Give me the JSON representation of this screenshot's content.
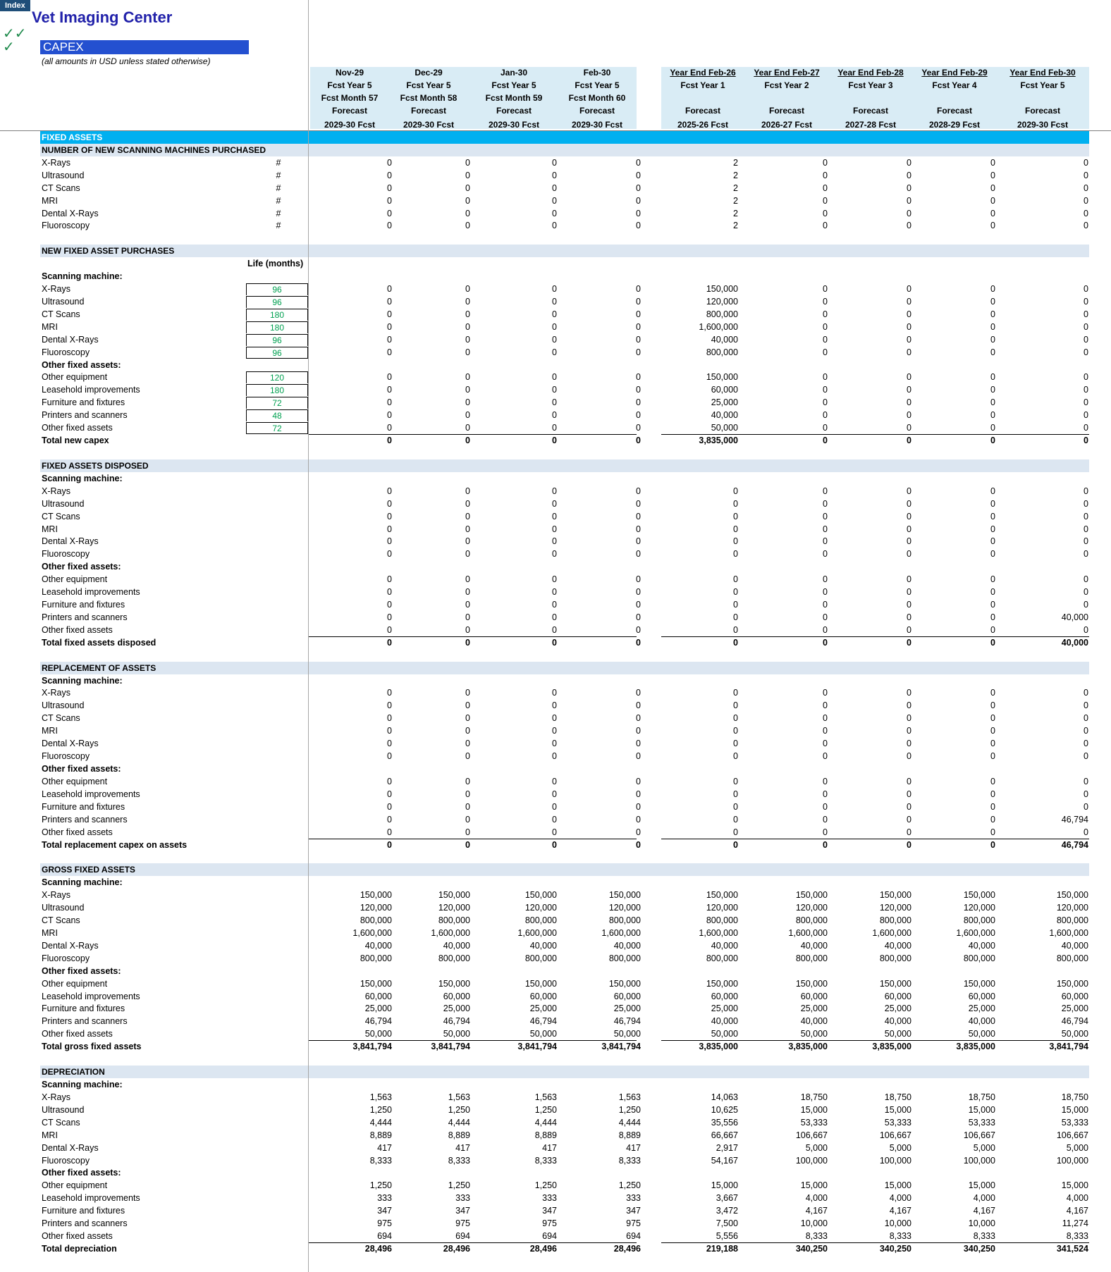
{
  "index_tab": "Index",
  "title": "Vet Imaging Center",
  "checks": [
    "✓✓",
    "✓"
  ],
  "sheet": {
    "title": "CAPEX",
    "subtitle": "(all amounts in USD unless stated otherwise)"
  },
  "colors": {
    "title": "#2222aa",
    "sheet_title_bg": "#2450d0",
    "section_bar": "#00b0f0",
    "section_band": "#dce6f1",
    "header_bg": "#d9ecf5",
    "life_text": "#00a050"
  },
  "columns": [
    {
      "lines": [
        "Nov-29",
        "Fcst Year 5",
        "Fcst Month 57",
        "Forecast",
        "2029-30 Fcst"
      ],
      "underline": false
    },
    {
      "lines": [
        "Dec-29",
        "Fcst Year 5",
        "Fcst Month 58",
        "Forecast",
        "2029-30 Fcst"
      ],
      "underline": false
    },
    {
      "lines": [
        "Jan-30",
        "Fcst Year 5",
        "Fcst Month 59",
        "Forecast",
        "2029-30 Fcst"
      ],
      "underline": false
    },
    {
      "lines": [
        "Feb-30",
        "Fcst Year 5",
        "Fcst Month 60",
        "Forecast",
        "2029-30 Fcst"
      ],
      "underline": false
    },
    {
      "lines": [
        "Year End  Feb-26",
        "Fcst Year 1",
        "",
        "Forecast",
        "2025-26 Fcst"
      ],
      "underline": true
    },
    {
      "lines": [
        "Year End  Feb-27",
        "Fcst Year 2",
        "",
        "Forecast",
        "2026-27 Fcst"
      ],
      "underline": true
    },
    {
      "lines": [
        "Year End  Feb-28",
        "Fcst Year 3",
        "",
        "Forecast",
        "2027-28 Fcst"
      ],
      "underline": true
    },
    {
      "lines": [
        "Year End  Feb-29",
        "Fcst Year 4",
        "",
        "Forecast",
        "2028-29 Fcst"
      ],
      "underline": true
    },
    {
      "lines": [
        "Year End  Feb-30",
        "Fcst Year 5",
        "",
        "Forecast",
        "2029-30 Fcst"
      ],
      "underline": true
    }
  ],
  "life_header": "Life (months)",
  "rows": [
    {
      "k": "bar",
      "label": "FIXED ASSETS"
    },
    {
      "k": "band",
      "label": "NUMBER OF NEW SCANNING MACHINES PURCHASED"
    },
    {
      "k": "data",
      "label": "X-Rays",
      "unit": "#",
      "v": [
        "0",
        "0",
        "0",
        "0",
        "2",
        "0",
        "0",
        "0",
        "0"
      ]
    },
    {
      "k": "data",
      "label": "Ultrasound",
      "unit": "#",
      "v": [
        "0",
        "0",
        "0",
        "0",
        "2",
        "0",
        "0",
        "0",
        "0"
      ]
    },
    {
      "k": "data",
      "label": "CT Scans",
      "unit": "#",
      "v": [
        "0",
        "0",
        "0",
        "0",
        "2",
        "0",
        "0",
        "0",
        "0"
      ]
    },
    {
      "k": "data",
      "label": "MRI",
      "unit": "#",
      "v": [
        "0",
        "0",
        "0",
        "0",
        "2",
        "0",
        "0",
        "0",
        "0"
      ]
    },
    {
      "k": "data",
      "label": "Dental X-Rays",
      "unit": "#",
      "v": [
        "0",
        "0",
        "0",
        "0",
        "2",
        "0",
        "0",
        "0",
        "0"
      ]
    },
    {
      "k": "data",
      "label": "Fluoroscopy",
      "unit": "#",
      "v": [
        "0",
        "0",
        "0",
        "0",
        "2",
        "0",
        "0",
        "0",
        "0"
      ]
    },
    {
      "k": "blank"
    },
    {
      "k": "band",
      "label": "NEW FIXED ASSET PURCHASES"
    },
    {
      "k": "lifehdr"
    },
    {
      "k": "sub",
      "label": "Scanning machine:"
    },
    {
      "k": "data",
      "label": "X-Rays",
      "life": "96",
      "v": [
        "0",
        "0",
        "0",
        "0",
        "150,000",
        "0",
        "0",
        "0",
        "0"
      ]
    },
    {
      "k": "data",
      "label": "Ultrasound",
      "life": "96",
      "v": [
        "0",
        "0",
        "0",
        "0",
        "120,000",
        "0",
        "0",
        "0",
        "0"
      ]
    },
    {
      "k": "data",
      "label": "CT Scans",
      "life": "180",
      "v": [
        "0",
        "0",
        "0",
        "0",
        "800,000",
        "0",
        "0",
        "0",
        "0"
      ]
    },
    {
      "k": "data",
      "label": "MRI",
      "life": "180",
      "v": [
        "0",
        "0",
        "0",
        "0",
        "1,600,000",
        "0",
        "0",
        "0",
        "0"
      ]
    },
    {
      "k": "data",
      "label": "Dental X-Rays",
      "life": "96",
      "v": [
        "0",
        "0",
        "0",
        "0",
        "40,000",
        "0",
        "0",
        "0",
        "0"
      ]
    },
    {
      "k": "data",
      "label": "Fluoroscopy",
      "life": "96",
      "lifelast": true,
      "v": [
        "0",
        "0",
        "0",
        "0",
        "800,000",
        "0",
        "0",
        "0",
        "0"
      ]
    },
    {
      "k": "sub",
      "label": "Other fixed assets:"
    },
    {
      "k": "data",
      "label": "Other equipment",
      "life": "120",
      "v": [
        "0",
        "0",
        "0",
        "0",
        "150,000",
        "0",
        "0",
        "0",
        "0"
      ]
    },
    {
      "k": "data",
      "label": "Leasehold improvements",
      "life": "180",
      "v": [
        "0",
        "0",
        "0",
        "0",
        "60,000",
        "0",
        "0",
        "0",
        "0"
      ]
    },
    {
      "k": "data",
      "label": "Furniture and fixtures",
      "life": "72",
      "v": [
        "0",
        "0",
        "0",
        "0",
        "25,000",
        "0",
        "0",
        "0",
        "0"
      ]
    },
    {
      "k": "data",
      "label": "Printers and scanners",
      "life": "48",
      "v": [
        "0",
        "0",
        "0",
        "0",
        "40,000",
        "0",
        "0",
        "0",
        "0"
      ]
    },
    {
      "k": "data",
      "label": "Other fixed assets",
      "life": "72",
      "lifelast": true,
      "v": [
        "0",
        "0",
        "0",
        "0",
        "50,000",
        "0",
        "0",
        "0",
        "0"
      ]
    },
    {
      "k": "total",
      "label": "Total new capex",
      "v": [
        "0",
        "0",
        "0",
        "0",
        "3,835,000",
        "0",
        "0",
        "0",
        "0"
      ]
    },
    {
      "k": "blank"
    },
    {
      "k": "band",
      "label": "FIXED ASSETS DISPOSED"
    },
    {
      "k": "sub",
      "label": "Scanning machine:"
    },
    {
      "k": "data",
      "label": "X-Rays",
      "v": [
        "0",
        "0",
        "0",
        "0",
        "0",
        "0",
        "0",
        "0",
        "0"
      ]
    },
    {
      "k": "data",
      "label": "Ultrasound",
      "v": [
        "0",
        "0",
        "0",
        "0",
        "0",
        "0",
        "0",
        "0",
        "0"
      ]
    },
    {
      "k": "data",
      "label": "CT Scans",
      "v": [
        "0",
        "0",
        "0",
        "0",
        "0",
        "0",
        "0",
        "0",
        "0"
      ]
    },
    {
      "k": "data",
      "label": "MRI",
      "v": [
        "0",
        "0",
        "0",
        "0",
        "0",
        "0",
        "0",
        "0",
        "0"
      ]
    },
    {
      "k": "data",
      "label": "Dental X-Rays",
      "v": [
        "0",
        "0",
        "0",
        "0",
        "0",
        "0",
        "0",
        "0",
        "0"
      ]
    },
    {
      "k": "data",
      "label": "Fluoroscopy",
      "v": [
        "0",
        "0",
        "0",
        "0",
        "0",
        "0",
        "0",
        "0",
        "0"
      ]
    },
    {
      "k": "sub",
      "label": "Other fixed assets:"
    },
    {
      "k": "data",
      "label": "Other equipment",
      "v": [
        "0",
        "0",
        "0",
        "0",
        "0",
        "0",
        "0",
        "0",
        "0"
      ]
    },
    {
      "k": "data",
      "label": "Leasehold improvements",
      "v": [
        "0",
        "0",
        "0",
        "0",
        "0",
        "0",
        "0",
        "0",
        "0"
      ]
    },
    {
      "k": "data",
      "label": "Furniture and fixtures",
      "v": [
        "0",
        "0",
        "0",
        "0",
        "0",
        "0",
        "0",
        "0",
        "0"
      ]
    },
    {
      "k": "data",
      "label": "Printers and scanners",
      "v": [
        "0",
        "0",
        "0",
        "0",
        "0",
        "0",
        "0",
        "0",
        "40,000"
      ]
    },
    {
      "k": "data",
      "label": "Other fixed assets",
      "v": [
        "0",
        "0",
        "0",
        "0",
        "0",
        "0",
        "0",
        "0",
        "0"
      ]
    },
    {
      "k": "total",
      "label": "Total fixed assets disposed",
      "v": [
        "0",
        "0",
        "0",
        "0",
        "0",
        "0",
        "0",
        "0",
        "40,000"
      ]
    },
    {
      "k": "blank"
    },
    {
      "k": "band",
      "label": "REPLACEMENT OF ASSETS"
    },
    {
      "k": "sub",
      "label": "Scanning machine:"
    },
    {
      "k": "data",
      "label": "X-Rays",
      "v": [
        "0",
        "0",
        "0",
        "0",
        "0",
        "0",
        "0",
        "0",
        "0"
      ]
    },
    {
      "k": "data",
      "label": "Ultrasound",
      "v": [
        "0",
        "0",
        "0",
        "0",
        "0",
        "0",
        "0",
        "0",
        "0"
      ]
    },
    {
      "k": "data",
      "label": "CT Scans",
      "v": [
        "0",
        "0",
        "0",
        "0",
        "0",
        "0",
        "0",
        "0",
        "0"
      ]
    },
    {
      "k": "data",
      "label": "MRI",
      "v": [
        "0",
        "0",
        "0",
        "0",
        "0",
        "0",
        "0",
        "0",
        "0"
      ]
    },
    {
      "k": "data",
      "label": "Dental X-Rays",
      "v": [
        "0",
        "0",
        "0",
        "0",
        "0",
        "0",
        "0",
        "0",
        "0"
      ]
    },
    {
      "k": "data",
      "label": "Fluoroscopy",
      "v": [
        "0",
        "0",
        "0",
        "0",
        "0",
        "0",
        "0",
        "0",
        "0"
      ]
    },
    {
      "k": "sub",
      "label": "Other fixed assets:"
    },
    {
      "k": "data",
      "label": "Other equipment",
      "v": [
        "0",
        "0",
        "0",
        "0",
        "0",
        "0",
        "0",
        "0",
        "0"
      ]
    },
    {
      "k": "data",
      "label": "Leasehold improvements",
      "v": [
        "0",
        "0",
        "0",
        "0",
        "0",
        "0",
        "0",
        "0",
        "0"
      ]
    },
    {
      "k": "data",
      "label": "Furniture and fixtures",
      "v": [
        "0",
        "0",
        "0",
        "0",
        "0",
        "0",
        "0",
        "0",
        "0"
      ]
    },
    {
      "k": "data",
      "label": "Printers and scanners",
      "v": [
        "0",
        "0",
        "0",
        "0",
        "0",
        "0",
        "0",
        "0",
        "46,794"
      ]
    },
    {
      "k": "data",
      "label": "Other fixed assets",
      "v": [
        "0",
        "0",
        "0",
        "0",
        "0",
        "0",
        "0",
        "0",
        "0"
      ]
    },
    {
      "k": "total",
      "label": "Total replacement capex on assets",
      "v": [
        "0",
        "0",
        "0",
        "0",
        "0",
        "0",
        "0",
        "0",
        "46,794"
      ]
    },
    {
      "k": "blank"
    },
    {
      "k": "band",
      "label": "GROSS FIXED ASSETS"
    },
    {
      "k": "sub",
      "label": "Scanning machine:"
    },
    {
      "k": "data",
      "label": "X-Rays",
      "v": [
        "150,000",
        "150,000",
        "150,000",
        "150,000",
        "150,000",
        "150,000",
        "150,000",
        "150,000",
        "150,000"
      ]
    },
    {
      "k": "data",
      "label": "Ultrasound",
      "v": [
        "120,000",
        "120,000",
        "120,000",
        "120,000",
        "120,000",
        "120,000",
        "120,000",
        "120,000",
        "120,000"
      ]
    },
    {
      "k": "data",
      "label": "CT Scans",
      "v": [
        "800,000",
        "800,000",
        "800,000",
        "800,000",
        "800,000",
        "800,000",
        "800,000",
        "800,000",
        "800,000"
      ]
    },
    {
      "k": "data",
      "label": "MRI",
      "v": [
        "1,600,000",
        "1,600,000",
        "1,600,000",
        "1,600,000",
        "1,600,000",
        "1,600,000",
        "1,600,000",
        "1,600,000",
        "1,600,000"
      ]
    },
    {
      "k": "data",
      "label": "Dental X-Rays",
      "v": [
        "40,000",
        "40,000",
        "40,000",
        "40,000",
        "40,000",
        "40,000",
        "40,000",
        "40,000",
        "40,000"
      ]
    },
    {
      "k": "data",
      "label": "Fluoroscopy",
      "v": [
        "800,000",
        "800,000",
        "800,000",
        "800,000",
        "800,000",
        "800,000",
        "800,000",
        "800,000",
        "800,000"
      ]
    },
    {
      "k": "sub",
      "label": "Other fixed assets:"
    },
    {
      "k": "data",
      "label": "Other equipment",
      "v": [
        "150,000",
        "150,000",
        "150,000",
        "150,000",
        "150,000",
        "150,000",
        "150,000",
        "150,000",
        "150,000"
      ]
    },
    {
      "k": "data",
      "label": "Leasehold improvements",
      "v": [
        "60,000",
        "60,000",
        "60,000",
        "60,000",
        "60,000",
        "60,000",
        "60,000",
        "60,000",
        "60,000"
      ]
    },
    {
      "k": "data",
      "label": "Furniture and fixtures",
      "v": [
        "25,000",
        "25,000",
        "25,000",
        "25,000",
        "25,000",
        "25,000",
        "25,000",
        "25,000",
        "25,000"
      ]
    },
    {
      "k": "data",
      "label": "Printers and scanners",
      "v": [
        "46,794",
        "46,794",
        "46,794",
        "46,794",
        "40,000",
        "40,000",
        "40,000",
        "40,000",
        "46,794"
      ]
    },
    {
      "k": "data",
      "label": "Other fixed assets",
      "v": [
        "50,000",
        "50,000",
        "50,000",
        "50,000",
        "50,000",
        "50,000",
        "50,000",
        "50,000",
        "50,000"
      ]
    },
    {
      "k": "total",
      "label": "Total gross fixed assets",
      "v": [
        "3,841,794",
        "3,841,794",
        "3,841,794",
        "3,841,794",
        "3,835,000",
        "3,835,000",
        "3,835,000",
        "3,835,000",
        "3,841,794"
      ]
    },
    {
      "k": "blank"
    },
    {
      "k": "band",
      "label": "DEPRECIATION"
    },
    {
      "k": "sub",
      "label": "Scanning machine:"
    },
    {
      "k": "data",
      "label": "X-Rays",
      "v": [
        "1,563",
        "1,563",
        "1,563",
        "1,563",
        "14,063",
        "18,750",
        "18,750",
        "18,750",
        "18,750"
      ]
    },
    {
      "k": "data",
      "label": "Ultrasound",
      "v": [
        "1,250",
        "1,250",
        "1,250",
        "1,250",
        "10,625",
        "15,000",
        "15,000",
        "15,000",
        "15,000"
      ]
    },
    {
      "k": "data",
      "label": "CT Scans",
      "v": [
        "4,444",
        "4,444",
        "4,444",
        "4,444",
        "35,556",
        "53,333",
        "53,333",
        "53,333",
        "53,333"
      ]
    },
    {
      "k": "data",
      "label": "MRI",
      "v": [
        "8,889",
        "8,889",
        "8,889",
        "8,889",
        "66,667",
        "106,667",
        "106,667",
        "106,667",
        "106,667"
      ]
    },
    {
      "k": "data",
      "label": "Dental X-Rays",
      "v": [
        "417",
        "417",
        "417",
        "417",
        "2,917",
        "5,000",
        "5,000",
        "5,000",
        "5,000"
      ]
    },
    {
      "k": "data",
      "label": "Fluoroscopy",
      "v": [
        "8,333",
        "8,333",
        "8,333",
        "8,333",
        "54,167",
        "100,000",
        "100,000",
        "100,000",
        "100,000"
      ]
    },
    {
      "k": "sub",
      "label": "Other fixed assets:"
    },
    {
      "k": "data",
      "label": "Other equipment",
      "v": [
        "1,250",
        "1,250",
        "1,250",
        "1,250",
        "15,000",
        "15,000",
        "15,000",
        "15,000",
        "15,000"
      ]
    },
    {
      "k": "data",
      "label": "Leasehold improvements",
      "v": [
        "333",
        "333",
        "333",
        "333",
        "3,667",
        "4,000",
        "4,000",
        "4,000",
        "4,000"
      ]
    },
    {
      "k": "data",
      "label": "Furniture and fixtures",
      "v": [
        "347",
        "347",
        "347",
        "347",
        "3,472",
        "4,167",
        "4,167",
        "4,167",
        "4,167"
      ]
    },
    {
      "k": "data",
      "label": "Printers and scanners",
      "v": [
        "975",
        "975",
        "975",
        "975",
        "7,500",
        "10,000",
        "10,000",
        "10,000",
        "11,274"
      ]
    },
    {
      "k": "data",
      "label": "Other fixed assets",
      "v": [
        "694",
        "694",
        "694",
        "694",
        "5,556",
        "8,333",
        "8,333",
        "8,333",
        "8,333"
      ]
    },
    {
      "k": "total",
      "label": "Total depreciation",
      "v": [
        "28,496",
        "28,496",
        "28,496",
        "28,496",
        "219,188",
        "340,250",
        "340,250",
        "340,250",
        "341,524"
      ]
    }
  ]
}
